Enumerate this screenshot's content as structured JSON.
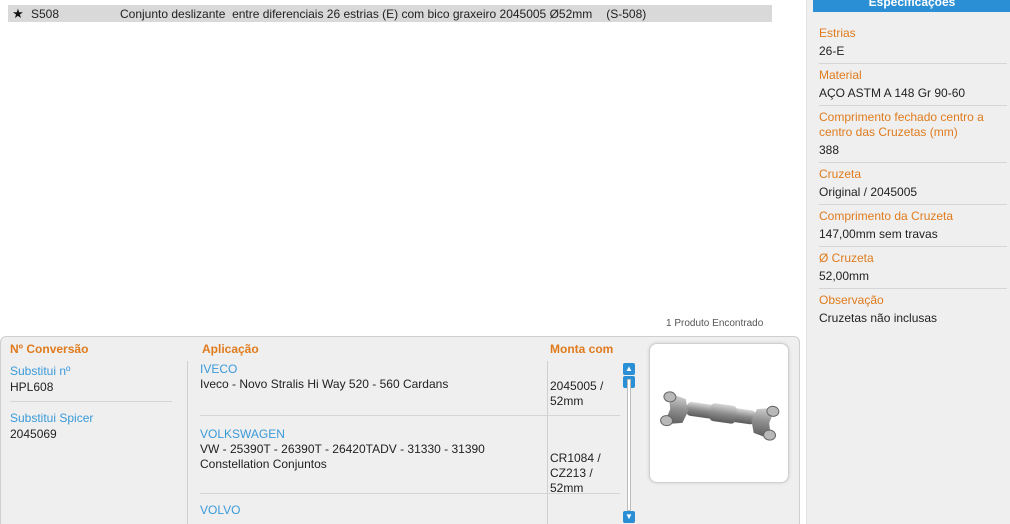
{
  "result": {
    "code": "S508",
    "description": "Conjunto deslizante  entre diferenciais 26 estrias (E) com bico graxeiro 2045005 Ø52mm",
    "reference": "(S-508)"
  },
  "found_count": "1 Produto Encontrado",
  "columns": {
    "conversion": "Nº Conversão",
    "application": "Aplicação",
    "fits_with": "Monta com"
  },
  "conversions": [
    {
      "label": "Substitui nº",
      "value": "HPL608"
    },
    {
      "label": "Substitui Spicer",
      "value": "2045069"
    }
  ],
  "applications": [
    {
      "brand": "IVECO",
      "text": "Iveco - Novo Stralis  Hi Way 520 - 560    Cardans",
      "fits": "2045005 / 52mm"
    },
    {
      "brand": "VOLKSWAGEN",
      "text": "VW -  25390T - 26390T - 26420TADV - 31330 - 31390 Constellation   Conjuntos",
      "fits": "CR1084 / CZ213 / 52mm"
    },
    {
      "brand": "VOLVO",
      "text": "",
      "fits": ""
    }
  ],
  "sidebar": {
    "title": "Especificações",
    "specs": [
      {
        "label": "Estrias",
        "value": "26-E"
      },
      {
        "label": "Material",
        "value": "AÇO ASTM A 148 Gr 90-60"
      },
      {
        "label": "Comprimento fechado centro a centro das Cruzetas (mm)",
        "value": "388"
      },
      {
        "label": "Cruzeta",
        "value": "Original / 2045005"
      },
      {
        "label": "Comprimento da Cruzeta",
        "value": "147,00mm sem travas"
      },
      {
        "label": "Ø Cruzeta",
        "value": "52,00mm"
      },
      {
        "label": "Observação",
        "value": "Cruzetas não inclusas"
      }
    ]
  },
  "colors": {
    "accent": "#e07b1d",
    "link": "#3a9ad9",
    "header_blue": "#2a8fd4"
  },
  "icons": {
    "favorite": "star-icon",
    "scroll_up": "arrow-up-icon",
    "scroll_down": "arrow-down-icon"
  }
}
